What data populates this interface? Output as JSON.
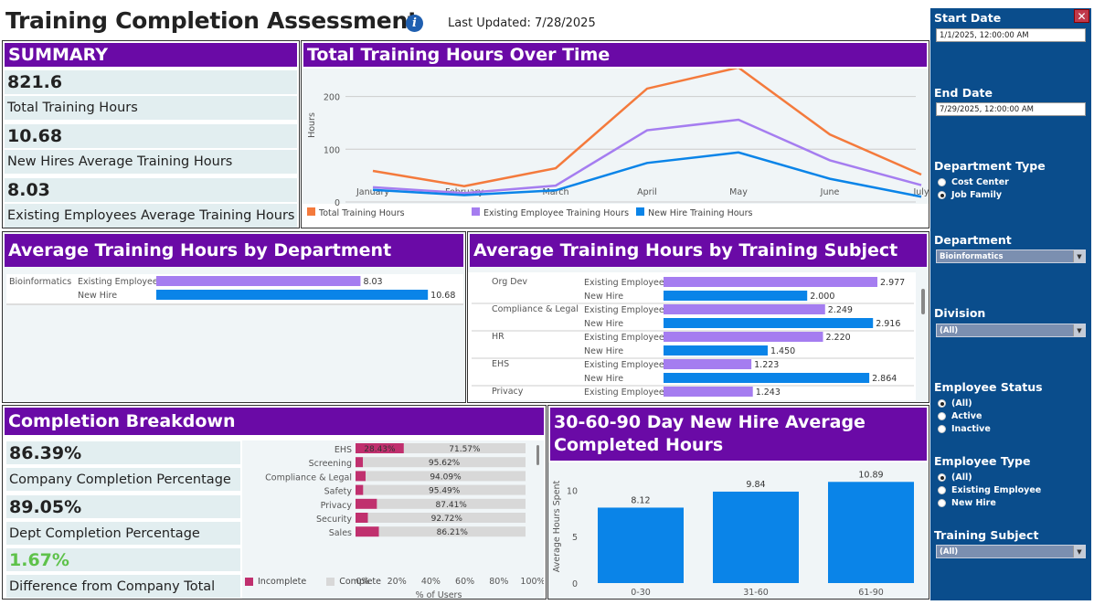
{
  "header": {
    "title": "Training Completion Assessment",
    "last_updated": "Last Updated: 7/28/2025"
  },
  "summary": {
    "title": "SUMMARY",
    "stats": [
      {
        "value": "821.6",
        "label": "Total Training Hours"
      },
      {
        "value": "10.68",
        "label": "New Hires Average Training Hours"
      },
      {
        "value": "8.03",
        "label": "Existing Employees Average Training Hours"
      }
    ]
  },
  "line_panel": {
    "title": "Total Training Hours Over Time"
  },
  "dept_panel": {
    "title": "Average Training Hours by Department"
  },
  "subject_panel": {
    "title": "Average Training Hours by Training Subject"
  },
  "completion": {
    "title": "Completion Breakdown",
    "stats": [
      {
        "value": "86.39%",
        "label": "Company Completion Percentage"
      },
      {
        "value": "89.05%",
        "label": "Dept Completion Percentage"
      },
      {
        "value": "1.67%",
        "label": "Difference from Company Total"
      }
    ]
  },
  "newhire_panel": {
    "title_line1": "30-60-90 Day New Hire Average",
    "title_line2": "Completed Hours"
  },
  "sidebar": {
    "start_label": "Start Date",
    "start_value": "1/1/2025, 12:00:00 AM",
    "end_label": "End Date",
    "end_value": "7/29/2025, 12:00:00 AM",
    "dept_type_label": "Department Type",
    "dept_type_options": [
      "Cost Center",
      "Job Family"
    ],
    "dept_label": "Department",
    "dept_value": "Bioinformatics",
    "division_label": "Division",
    "division_value": "(All)",
    "status_label": "Employee Status",
    "status_options": [
      "(All)",
      "Active",
      "Inactive"
    ],
    "type_label": "Employee Type",
    "type_options": [
      "(All)",
      "Existing Employee",
      "New Hire"
    ],
    "subject_label": "Training Subject",
    "subject_value": "(All)"
  },
  "colors": {
    "purple": "#6a0aa6",
    "orange": "#f47a3c",
    "lavender": "#a57df0",
    "blue": "#0a84e8",
    "incomplete": "#c0306e",
    "complete": "#d8d8d8",
    "sidebar": "#0a4d8c",
    "green": "#5ec24a"
  },
  "chart_data": [
    {
      "type": "line",
      "title": "Total Training Hours Over Time",
      "ylabel": "Hours",
      "x": [
        "January",
        "February",
        "March",
        "April",
        "May",
        "June",
        "July"
      ],
      "yticks": [
        0,
        100,
        200
      ],
      "ylim": [
        0,
        260
      ],
      "series": [
        {
          "name": "Total Training Hours",
          "values": [
            59,
            30,
            64,
            215,
            255,
            128,
            52
          ]
        },
        {
          "name": "Existing Employee Training Hours",
          "values": [
            28,
            17,
            31,
            136,
            156,
            79,
            32
          ]
        },
        {
          "name": "New Hire Training Hours",
          "values": [
            23,
            13,
            22,
            74,
            94,
            44,
            10
          ]
        }
      ]
    },
    {
      "type": "bar",
      "title": "Average Training Hours by Department",
      "categories": [
        "Bioinformatics"
      ],
      "series": [
        {
          "name": "Existing Employee",
          "values": [
            8.03
          ]
        },
        {
          "name": "New Hire",
          "values": [
            10.68
          ]
        }
      ],
      "value_labels": [
        "8.03",
        "10.68"
      ],
      "xlim": [
        0,
        11.5
      ]
    },
    {
      "type": "bar",
      "title": "Average Training Hours by Training Subject",
      "categories": [
        "Org Dev",
        "Compliance & Legal",
        "HR",
        "EHS",
        "Privacy"
      ],
      "series": [
        {
          "name": "Existing Employee",
          "values": [
            2.977,
            2.249,
            2.22,
            1.223,
            1.243
          ],
          "labels": [
            "2.977",
            "2.249",
            "2.220",
            "1.223",
            "1.243"
          ]
        },
        {
          "name": "New Hire",
          "values": [
            2.0,
            2.916,
            1.45,
            2.864,
            null
          ],
          "labels": [
            "2.000",
            "2.916",
            "1.450",
            "2.864",
            ""
          ]
        }
      ],
      "xlim": [
        0,
        3.1
      ]
    },
    {
      "type": "bar",
      "subtype": "stacked-horizontal-100",
      "categories": [
        "EHS",
        "Screening",
        "Compliance & Legal",
        "Safety",
        "Privacy",
        "Security",
        "Sales"
      ],
      "incomplete": [
        28.43,
        4.38,
        5.91,
        4.51,
        12.59,
        7.28,
        13.79
      ],
      "complete": [
        71.57,
        95.62,
        94.09,
        95.49,
        87.41,
        92.72,
        86.21
      ],
      "labels": [
        "28.43%",
        "71.57%",
        "95.62%",
        "94.09%",
        "95.49%",
        "87.41%",
        "92.72%",
        "86.21%"
      ],
      "xticks": [
        "0%",
        "20%",
        "40%",
        "60%",
        "80%",
        "100%"
      ],
      "xlabel": "% of Users",
      "legend": [
        "Incomplete",
        "Complete"
      ]
    },
    {
      "type": "bar",
      "title": "30-60-90 Day New Hire Average Completed Hours",
      "categories": [
        "0-30",
        "31-60",
        "61-90"
      ],
      "values": [
        8.12,
        9.84,
        10.89
      ],
      "labels": [
        "8.12",
        "9.84",
        "10.89"
      ],
      "ylabel": "Average Hours Spent",
      "yticks": [
        0,
        5,
        10
      ],
      "ylim": [
        0,
        12
      ]
    }
  ]
}
